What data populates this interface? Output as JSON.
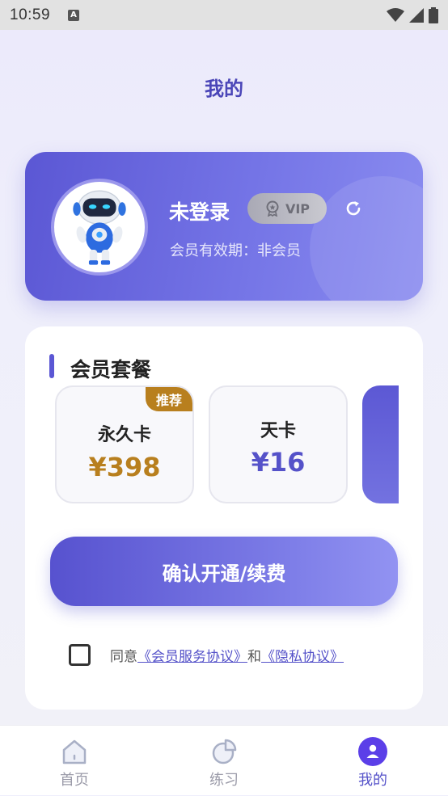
{
  "status_bar": {
    "time": "10:59",
    "indicator": "A"
  },
  "header": {
    "title": "我的"
  },
  "profile": {
    "name": "未登录",
    "vip_label": "VIP",
    "expire_text": "会员有效期：非会员"
  },
  "membership": {
    "section_title": "会员套餐",
    "plans": [
      {
        "name": "永久卡",
        "price": "¥398",
        "tag": "推荐"
      },
      {
        "name": "天卡",
        "price": "¥16"
      }
    ],
    "confirm_label": "确认开通/续费"
  },
  "agreement": {
    "prefix": "同意",
    "service_link": "《会员服务协议》",
    "joiner": "和",
    "privacy_link": "《隐私协议》"
  },
  "tabbar": {
    "items": [
      {
        "label": "首页",
        "icon": "home-icon"
      },
      {
        "label": "练习",
        "icon": "chart-icon"
      },
      {
        "label": "我的",
        "icon": "user-icon"
      }
    ],
    "active_index": 2
  },
  "colors": {
    "accent": "#5552c9",
    "price_gold": "#b87f1e",
    "page_bg": "#eeeefc"
  }
}
